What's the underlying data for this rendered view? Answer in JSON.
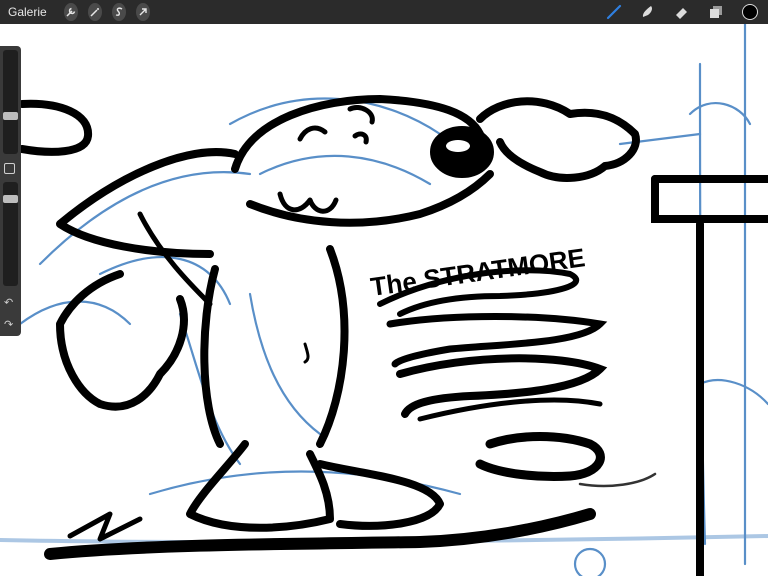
{
  "topbar": {
    "gallery_label": "Galerie",
    "left_tools": [
      "wrench-icon",
      "magic-wand-icon",
      "selection-s-icon",
      "transform-arrow-icon"
    ],
    "right_tools": [
      "brush-icon",
      "smudge-icon",
      "eraser-icon",
      "layers-icon",
      "color-swatch"
    ],
    "active_tool_color": "#2f7fe0",
    "current_color": "#000000"
  },
  "sidebar": {
    "brush_size_level": 0.7,
    "opacity_level": 0.88
  },
  "canvas": {
    "sketch_text": "The STRATMORE",
    "ink_color": "#000000",
    "sketch_color": "#3b7bbf"
  }
}
